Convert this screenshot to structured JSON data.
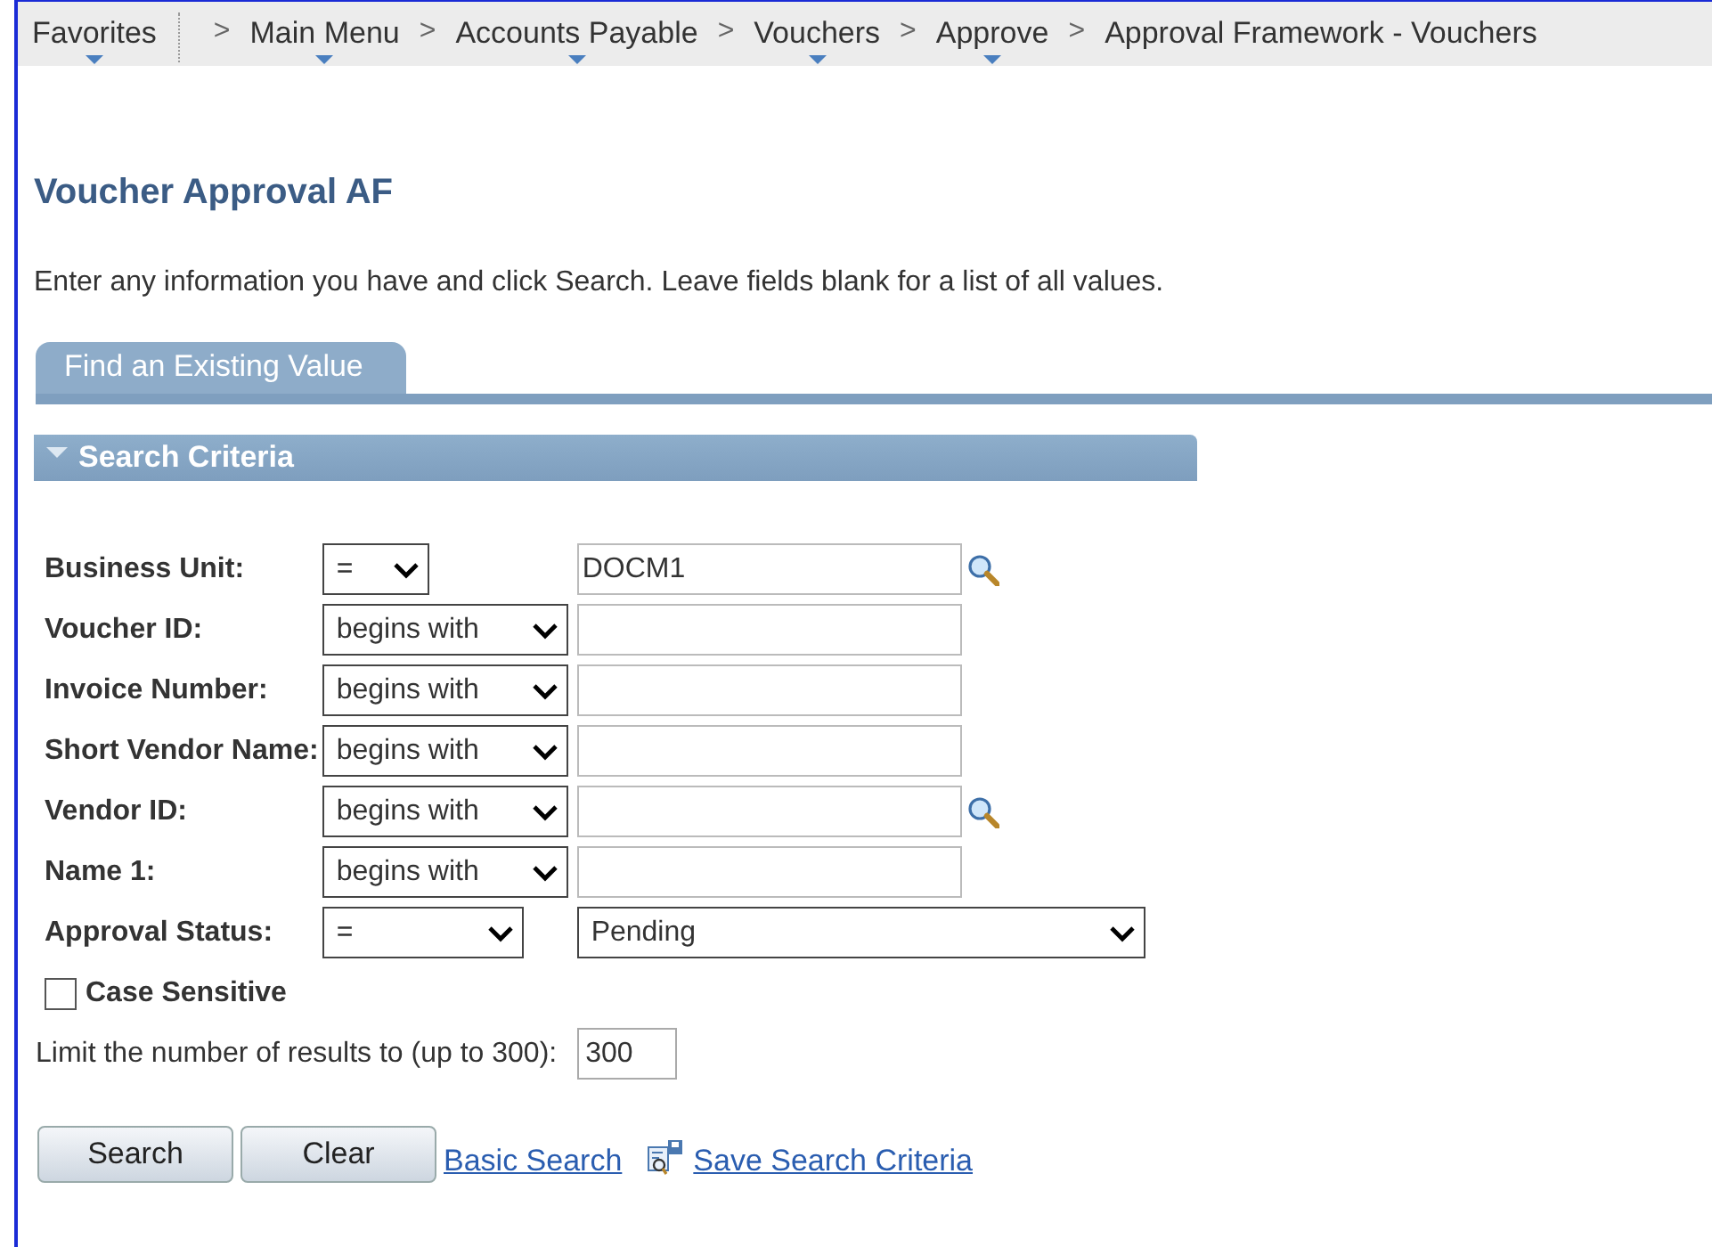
{
  "breadcrumb": [
    {
      "label": "Favorites",
      "menu": true
    },
    {
      "separator": ">",
      "label": "Main Menu",
      "menu": true
    },
    {
      "separator": ">",
      "label": "Accounts Payable",
      "menu": true
    },
    {
      "separator": ">",
      "label": "Vouchers",
      "menu": true
    },
    {
      "separator": ">",
      "label": "Approve",
      "menu": true
    },
    {
      "separator": ">",
      "label": "Approval Framework - Vouchers",
      "menu": false
    }
  ],
  "page_title": "Voucher Approval AF",
  "instructions": "Enter any information you have and click Search. Leave fields blank for a list of all values.",
  "tabs": [
    {
      "label": "Find an Existing Value",
      "selected": true
    }
  ],
  "section": {
    "title": "Search Criteria",
    "expanded": true
  },
  "fields": [
    {
      "kind": "lookup",
      "label": "Business Unit:",
      "operator": "=",
      "value": "DOCM1"
    },
    {
      "kind": "text",
      "label": "Voucher ID:",
      "operator": "begins with"
    },
    {
      "kind": "text",
      "label": "Invoice Number:",
      "operator": "begins with"
    },
    {
      "kind": "text",
      "label": "Short Vendor Name:",
      "operator": "begins with"
    },
    {
      "kind": "lookup",
      "label": "Vendor ID:",
      "operator": "begins with"
    },
    {
      "kind": "text",
      "label": "Name 1:",
      "operator": "begins with"
    },
    {
      "kind": "select",
      "label": "Approval Status:",
      "operator": "=",
      "value": "Pending"
    }
  ],
  "case_sensitive": {
    "label": "Case Sensitive",
    "checked": false
  },
  "limit": {
    "label": "Limit the number of results to (up to 300):",
    "value": "300"
  },
  "buttons": [
    {
      "label": "Search"
    },
    {
      "label": "Clear"
    }
  ],
  "links": [
    {
      "kind": "plain",
      "label": "Basic Search"
    },
    {
      "kind": "icon",
      "label": "Save Search Criteria"
    }
  ]
}
